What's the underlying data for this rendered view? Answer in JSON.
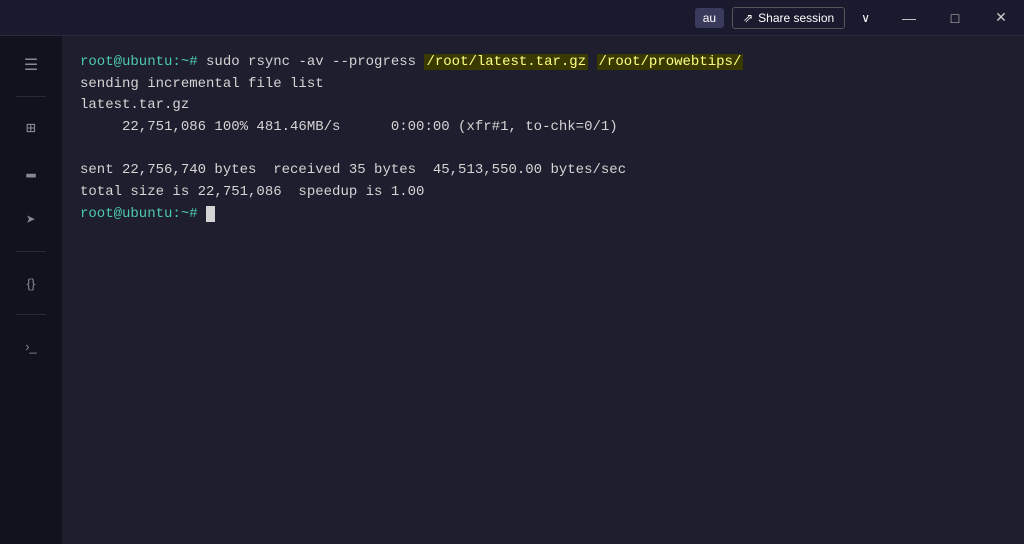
{
  "titlebar": {
    "user_badge": "au",
    "share_label": "Share session",
    "chevron_down": "∨",
    "minimize": "—",
    "maximize": "□",
    "close": "✕"
  },
  "sidebar": {
    "items": [
      {
        "icon": "☰",
        "name": "menu"
      },
      {
        "icon": "⊞",
        "name": "grid"
      },
      {
        "icon": "📁",
        "name": "folder"
      },
      {
        "icon": "➤",
        "name": "forward"
      },
      {
        "icon": "{}",
        "name": "code"
      },
      {
        "icon": ">_",
        "name": "terminal"
      }
    ]
  },
  "terminal": {
    "lines": [
      {
        "type": "command",
        "prompt": "root@ubuntu:~#",
        "command": "sudo rsync -av --progress /root/latest.tar.gz  /root/prowebtips/"
      },
      {
        "type": "output",
        "text": "sending incremental file list"
      },
      {
        "type": "output",
        "text": "latest.tar.gz"
      },
      {
        "type": "output",
        "text": "     22,751,086 100%  481.46MB/s      0:00:00 (xfr#1, to-chk=0/1)"
      },
      {
        "type": "output",
        "text": ""
      },
      {
        "type": "output",
        "text": "sent 22,756,740 bytes  received 35 bytes  45,513,550.00 bytes/sec"
      },
      {
        "type": "output",
        "text": "total size is 22,751,086  speedup is 1.00"
      },
      {
        "type": "prompt_cursor",
        "prompt": "root@ubuntu:~#"
      }
    ]
  }
}
